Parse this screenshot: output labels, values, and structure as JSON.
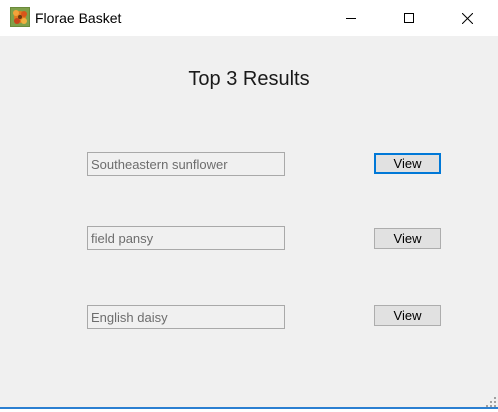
{
  "window": {
    "title": "Florae Basket",
    "icon": "flower-basket-icon",
    "controls": {
      "minimize_icon": "minimize-icon",
      "maximize_icon": "maximize-icon",
      "close_icon": "close-icon"
    }
  },
  "main": {
    "heading": "Top 3 Results",
    "results": [
      {
        "name": "Southeastern sunflower",
        "button_label": "View"
      },
      {
        "name": "field pansy",
        "button_label": "View"
      },
      {
        "name": "English daisy",
        "button_label": "View"
      }
    ]
  },
  "colors": {
    "window_bg": "#f0f0f0",
    "titlebar_bg": "#ffffff",
    "focus_accent": "#0078d7",
    "button_bg": "#e1e1e1"
  }
}
